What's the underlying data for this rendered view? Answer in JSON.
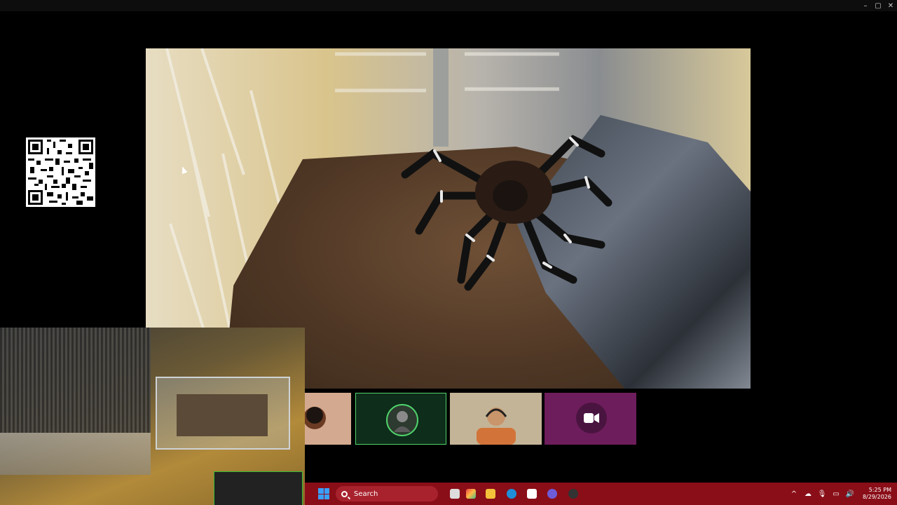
{
  "window": {
    "controls": [
      "–",
      "▢",
      "✕"
    ]
  },
  "taskbar": {
    "search_label": "Search",
    "clock_time": "5:25 PM",
    "clock_date": "8/29/2026",
    "tray_icons": [
      "^",
      "☁",
      "🎙",
      "▭",
      "🔊"
    ]
  },
  "colors": {
    "taskbar": "#8a0e18",
    "active_tile_border": "#4fd36b",
    "camera_tile": "#6e1d5c"
  },
  "icons": {
    "participant_2": "avatar-icon",
    "participant_4": "video-camera-icon",
    "start": "windows-start-icon",
    "search": "search-icon"
  }
}
